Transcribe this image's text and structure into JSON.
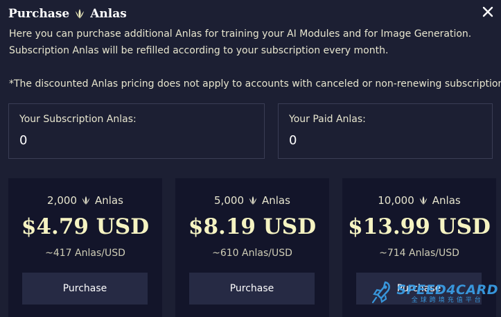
{
  "header": {
    "title_left": "Purchase",
    "title_right": "Anlas",
    "icons": {
      "title_icon": "anlas-icon",
      "close": "close-icon"
    }
  },
  "description": {
    "line1": "Here you can purchase additional Anlas for training your AI Modules and for Image Generation.",
    "line2": "Subscription Anlas will be refilled according to your subscription every month.",
    "note": "*The discounted Anlas pricing does not apply to accounts with canceled or non-renewing subscriptions."
  },
  "balances": {
    "subscription": {
      "label": "Your Subscription Anlas:",
      "value": "0"
    },
    "paid": {
      "label": "Your Paid Anlas:",
      "value": "0"
    }
  },
  "packages": [
    {
      "amount": "2,000",
      "unit": "Anlas",
      "price": "$4.79 USD",
      "rate": "~417 Anlas/USD",
      "button": "Purchase"
    },
    {
      "amount": "5,000",
      "unit": "Anlas",
      "price": "$8.19 USD",
      "rate": "~610 Anlas/USD",
      "button": "Purchase"
    },
    {
      "amount": "10,000",
      "unit": "Anlas",
      "price": "$13.99 USD",
      "rate": "~714 Anlas/USD",
      "button": "Purchase"
    }
  ],
  "watermark": {
    "name": "SPEED4CARD",
    "tagline": "全球跨境充值平台",
    "icon": "rocket-icon"
  },
  "colors": {
    "background": "#1c1f33",
    "card": "#13152a",
    "button": "#262a44",
    "accent_text": "#f5f3c2",
    "watermark": "#3aa0e8"
  }
}
